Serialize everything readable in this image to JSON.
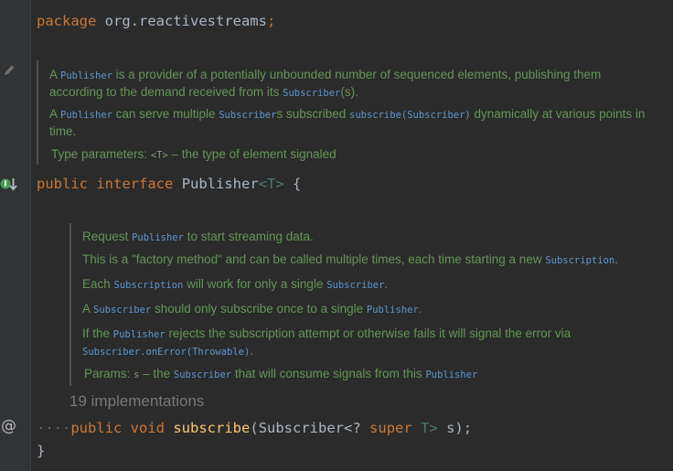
{
  "code": {
    "package_kw": "package",
    "package_name": "org.reactivestreams",
    "semicolon": ";",
    "kw_public": "public",
    "kw_interface": "interface",
    "class_name": "Publisher",
    "type_param": "<T>",
    "open_brace": "{",
    "kw_void": "void",
    "method_name": "subscribe",
    "open_paren": "(",
    "param_type": "Subscriber",
    "wildcard": "<?",
    "kw_super": "super",
    "wildcard_close": "T>",
    "param_name": "s",
    "close_stmt": ");",
    "close_brace": "}",
    "indent_dots": "····"
  },
  "class_doc": {
    "p1_a": "A ",
    "p1_code1": "Publisher",
    "p1_b": " is a provider of a potentially unbounded number of sequenced elements, publishing them",
    "p1_c": "according to the demand received from its ",
    "p1_code2": "Subscriber",
    "p1_d": "(s).",
    "p2_a": "A ",
    "p2_code1": "Publisher",
    "p2_b": " can serve multiple ",
    "p2_code2": "Subscriber",
    "p2_c": "s subscribed ",
    "p2_code3": "subscribe(Subscriber)",
    "p2_d": " dynamically at various points in",
    "p2_e": "time.",
    "tp_label": "Type parameters: ",
    "tp_code": "<T>",
    "tp_desc": " – the type of element signaled"
  },
  "method_doc": {
    "p1_a": "Request ",
    "p1_code": "Publisher",
    "p1_b": " to start streaming data.",
    "p2_a": "This is a \"factory method\" and can be called multiple times, each time starting a new ",
    "p2_code": "Subscription",
    "p2_b": ".",
    "p3_a": "Each ",
    "p3_code1": "Subscription",
    "p3_b": " will work for only a single ",
    "p3_code2": "Subscriber",
    "p3_c": ".",
    "p4_a": "A ",
    "p4_code1": "Subscriber",
    "p4_b": " should only subscribe once to a single ",
    "p4_code2": "Publisher",
    "p4_c": ".",
    "p5_a": "If the ",
    "p5_code1": "Publisher",
    "p5_b": " rejects the subscription attempt or otherwise fails it will signal the error via",
    "p5_code2": "Subscriber.onError(Throwable)",
    "p5_c": ".",
    "params_label": "Params: ",
    "params_code1": "s",
    "params_b": " – the ",
    "params_code2": "Subscriber",
    "params_c": " that will consume signals from this ",
    "params_code3": "Publisher"
  },
  "hint": {
    "implementations": "19 implementations"
  },
  "gutter": {
    "icons": [
      "pencil-icon",
      "implemented-icon",
      "override-icon"
    ],
    "at_symbol": "@"
  },
  "colors": {
    "background": "#2b2b2b",
    "keyword": "#cc7832",
    "method": "#ffc66d",
    "doc_text": "#629755",
    "doc_code": "#5c97d0",
    "type_param": "#507874"
  }
}
